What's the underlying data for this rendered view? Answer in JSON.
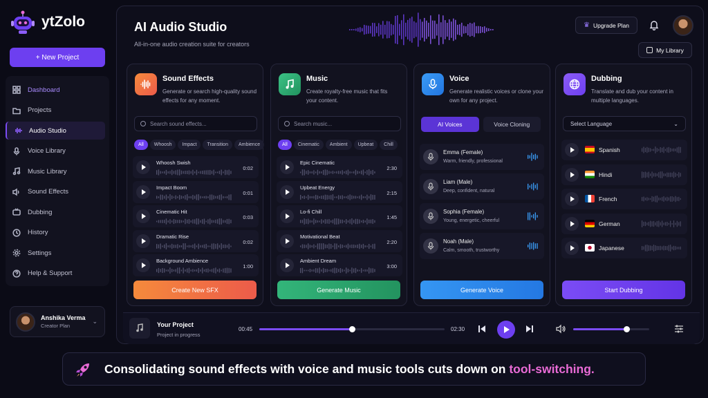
{
  "app": {
    "name": "ytZolo"
  },
  "sidebar": {
    "new_project": "+ New Project",
    "items": [
      {
        "label": "Dashboard",
        "active": false
      },
      {
        "label": "Projects"
      },
      {
        "label": "Audio Studio",
        "active": true
      },
      {
        "label": "Voice Library"
      },
      {
        "label": "Music Library"
      },
      {
        "label": "Sound Effects"
      },
      {
        "label": "Dubbing"
      },
      {
        "label": "History"
      },
      {
        "label": "Settings"
      },
      {
        "label": "Help & Support"
      }
    ],
    "user": {
      "name": "Anshika Verma",
      "plan": "Creator Plan"
    }
  },
  "header": {
    "title": "AI Audio Studio",
    "subtitle": "All-in-one audio creation suite for creators",
    "upgrade": "Upgrade Plan",
    "my_library": "My Library"
  },
  "sfx": {
    "title": "Sound Effects",
    "desc": "Generate or search high-quality sound effects for any moment.",
    "placeholder": "Search sound effects...",
    "chips": [
      "All",
      "Whoosh",
      "Impact",
      "Transition",
      "Ambience"
    ],
    "rows": [
      {
        "name": "Whoosh Swish",
        "dur": "0:02"
      },
      {
        "name": "Impact Boom",
        "dur": "0:01"
      },
      {
        "name": "Cinematic Hit",
        "dur": "0:03"
      },
      {
        "name": "Dramatic Rise",
        "dur": "0:02"
      },
      {
        "name": "Background Ambience",
        "dur": "1:00"
      }
    ],
    "cta": "Create New SFX"
  },
  "music": {
    "title": "Music",
    "desc": "Create royalty-free music that fits your content.",
    "placeholder": "Search music...",
    "chips": [
      "All",
      "Cinematic",
      "Ambient",
      "Upbeat",
      "Chill"
    ],
    "rows": [
      {
        "name": "Epic Cinematic",
        "dur": "2:30"
      },
      {
        "name": "Upbeat Energy",
        "dur": "2:15"
      },
      {
        "name": "Lo-fi Chill",
        "dur": "1:45"
      },
      {
        "name": "Motivational Beat",
        "dur": "2:20"
      },
      {
        "name": "Ambient Dream",
        "dur": "3:00"
      }
    ],
    "cta": "Generate Music"
  },
  "voice": {
    "title": "Voice",
    "desc": "Generate realistic voices or clone your own for any project.",
    "tabs": [
      "AI Voices",
      "Voice Cloning"
    ],
    "rows": [
      {
        "name": "Emma (Female)",
        "desc": "Warm, friendly, professional"
      },
      {
        "name": "Liam (Male)",
        "desc": "Deep, confident, natural"
      },
      {
        "name": "Sophia (Female)",
        "desc": "Young, energetic, cheerful"
      },
      {
        "name": "Noah (Male)",
        "desc": "Calm, smooth, trustworthy"
      }
    ],
    "cta": "Generate Voice"
  },
  "dubbing": {
    "title": "Dubbing",
    "desc": "Translate and dub your content in multiple languages.",
    "select": "Select Language",
    "rows": [
      {
        "name": "Spanish",
        "flag": "es"
      },
      {
        "name": "Hindi",
        "flag": "in"
      },
      {
        "name": "French",
        "flag": "fr"
      },
      {
        "name": "German",
        "flag": "de"
      },
      {
        "name": "Japanese",
        "flag": "jp"
      }
    ],
    "cta": "Start Dubbing"
  },
  "player": {
    "name": "Your Project",
    "status": "Project in progress",
    "current": "00:45",
    "total": "02:30",
    "progress": 0.5,
    "volume": 0.7
  },
  "banner": {
    "text": "Consolidating sound effects with voice and music tools cuts down on ",
    "highlight": "tool-switching."
  },
  "colors": {
    "accent": "#6d3ff0",
    "sfx": "#f26b3a",
    "music": "#2fae73",
    "voice": "#2f8bf0",
    "dubbing": "#7b4cf5",
    "highlight": "#e96bd6"
  }
}
